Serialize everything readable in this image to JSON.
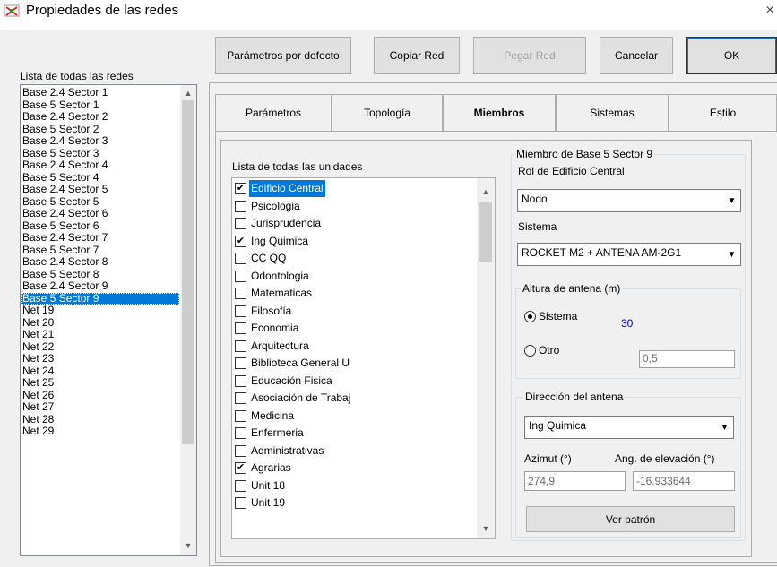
{
  "window": {
    "title": "Propiedades de las redes",
    "close_glyph": "×"
  },
  "toolbar": {
    "defaults_label": "Parámetros por defecto",
    "copy_label": "Copiar Red",
    "paste_label": "Pegar Red",
    "cancel_label": "Cancelar",
    "ok_label": "OK"
  },
  "networks": {
    "header": "Lista de todas las redes",
    "selected": "Base 5 Sector 9",
    "items": [
      "Base 2.4 Sector 1",
      "Base 5 Sector 1",
      "Base 2.4 Sector 2",
      "Base 5 Sector 2",
      "Base 2.4 Sector 3",
      "Base 5 Sector 3",
      "Base 2.4 Sector 4",
      "Base 5 Sector 4",
      "Base 2.4 Sector 5",
      "Base 5 Sector 5",
      "Base 2.4 Sector 6",
      "Base 5 Sector 6",
      "Base 2.4 Sector 7",
      "Base 5 Sector 7",
      "Base 2.4 Sector 8",
      "Base 5 Sector 8",
      "Base 2.4 Sector 9",
      "Base 5 Sector 9",
      "Net 19",
      "Net 20",
      "Net 21",
      "Net 22",
      "Net 23",
      "Net 24",
      "Net 25",
      "Net 26",
      "Net 27",
      "Net 28",
      "Net 29"
    ]
  },
  "tabs": {
    "parametros": "Parámetros",
    "topologia": "Topología",
    "miembros": "Miembros",
    "sistemas": "Sistemas",
    "estilo": "Estilo",
    "active": "Miembros"
  },
  "units": {
    "header": "Lista de todas las unidades",
    "check_glyph": "✔",
    "items": [
      {
        "label": "Edificio Central",
        "checked": true,
        "selected": true
      },
      {
        "label": "Psicologia",
        "checked": false
      },
      {
        "label": "Jurisprudencia",
        "checked": false
      },
      {
        "label": "Ing Quimica",
        "checked": true
      },
      {
        "label": "CC QQ",
        "checked": false
      },
      {
        "label": "Odontologia",
        "checked": false
      },
      {
        "label": "Matematicas",
        "checked": false
      },
      {
        "label": "Filosofía",
        "checked": false
      },
      {
        "label": "Economia",
        "checked": false
      },
      {
        "label": "Arquitectura",
        "checked": false
      },
      {
        "label": "Biblioteca General U",
        "checked": false
      },
      {
        "label": "Educación Fisica",
        "checked": false
      },
      {
        "label": "Asociación de Trabaj",
        "checked": false
      },
      {
        "label": "Medicina",
        "checked": false
      },
      {
        "label": "Enfermeria",
        "checked": false
      },
      {
        "label": "Administrativas",
        "checked": false
      },
      {
        "label": "Agrarias",
        "checked": true
      },
      {
        "label": "Unit  18",
        "checked": false
      },
      {
        "label": "Unit  19",
        "checked": false
      }
    ]
  },
  "member": {
    "group_title": "Miembro de Base 5 Sector 9",
    "role_label": "Rol de Edificio Central",
    "role_value": "Nodo",
    "system_label": "Sistema",
    "system_value": "ROCKET M2 + ANTENA AM-2G1",
    "antenna_height": {
      "title": "Altura de antena (m)",
      "sistema_label": "Sistema",
      "sistema_value": "30",
      "otro_label": "Otro",
      "otro_value": "0,5",
      "selected": "Sistema"
    },
    "direction": {
      "title": "Dirección del antena",
      "target_value": "Ing Quimica",
      "azimut_label": "Azimut (°)",
      "elevation_label": "Ang. de elevación (°)",
      "azimut_value": "274,9",
      "elevation_value": "-16,933644",
      "pattern_button": "Ver patrón"
    }
  },
  "colors": {
    "selection": "#0078d7",
    "value_blue": "#0000cc",
    "dialog_bg": "#f0f0f0"
  },
  "icons": {
    "app": "network-props-icon",
    "dropdown": "▼",
    "scroll_up": "▲",
    "scroll_down": "▼"
  }
}
